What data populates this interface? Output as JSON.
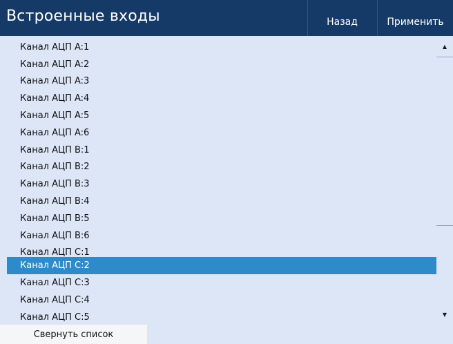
{
  "header": {
    "title": "Встроенные входы",
    "back_label": "Назад",
    "apply_label": "Применить"
  },
  "list": {
    "items": [
      "Канал АЦП A:1",
      "Канал АЦП A:2",
      "Канал АЦП A:3",
      "Канал АЦП A:4",
      "Канал АЦП A:5",
      "Канал АЦП A:6",
      "Канал АЦП B:1",
      "Канал АЦП B:2",
      "Канал АЦП B:3",
      "Канал АЦП B:4",
      "Канал АЦП B:5",
      "Канал АЦП B:6",
      "Канал АЦП C:1",
      "Канал АЦП C:2",
      "Канал АЦП C:3",
      "Канал АЦП C:4",
      "Канал АЦП C:5"
    ],
    "selected_item": "Канал АЦП C:2"
  },
  "scrollbar": {
    "up_icon": "▲",
    "down_icon": "▼"
  },
  "footer": {
    "collapse_label": "Свернуть список"
  },
  "colors": {
    "header_bg": "#163a68",
    "list_bg": "#dde6f7",
    "selected_bg": "#2f8ac9"
  }
}
